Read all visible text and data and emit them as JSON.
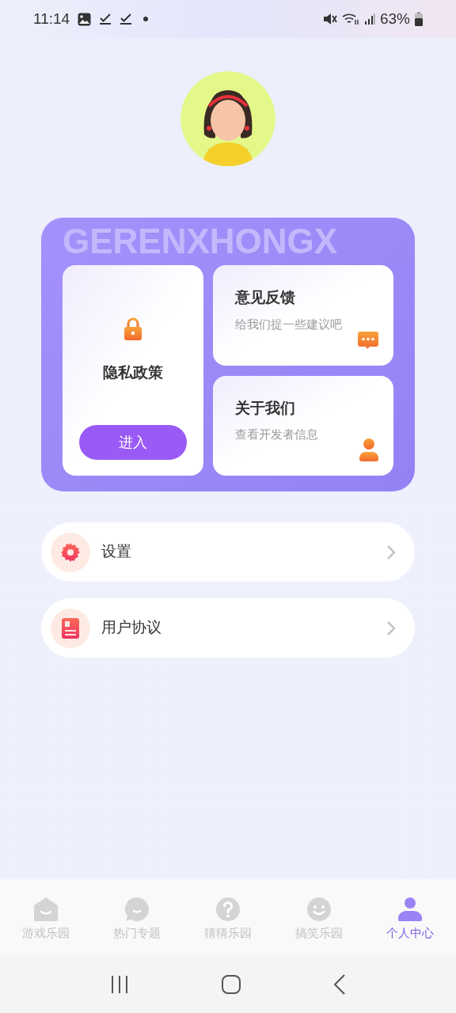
{
  "status_bar": {
    "time": "11:14",
    "battery": "63%"
  },
  "feature_panel": {
    "watermark": "GERENXHONGX",
    "main_card": {
      "title": "隐私政策",
      "button": "进入"
    },
    "cards": [
      {
        "title": "意见反馈",
        "subtitle": "给我们提一些建议吧",
        "kind": "chat"
      },
      {
        "title": "关于我们",
        "subtitle": "查看开发者信息",
        "kind": "person"
      }
    ]
  },
  "menu": [
    {
      "label": "设置",
      "kind": "gear"
    },
    {
      "label": "用户协议",
      "kind": "document"
    }
  ],
  "tabs": [
    {
      "label": "游戏乐园",
      "kind": "house",
      "selected": false
    },
    {
      "label": "热门专题",
      "kind": "bubble",
      "selected": false
    },
    {
      "label": "猜猜乐园",
      "kind": "question",
      "selected": false
    },
    {
      "label": "搞笑乐园",
      "kind": "smile",
      "selected": false
    },
    {
      "label": "个人中心",
      "kind": "person",
      "selected": true
    }
  ]
}
